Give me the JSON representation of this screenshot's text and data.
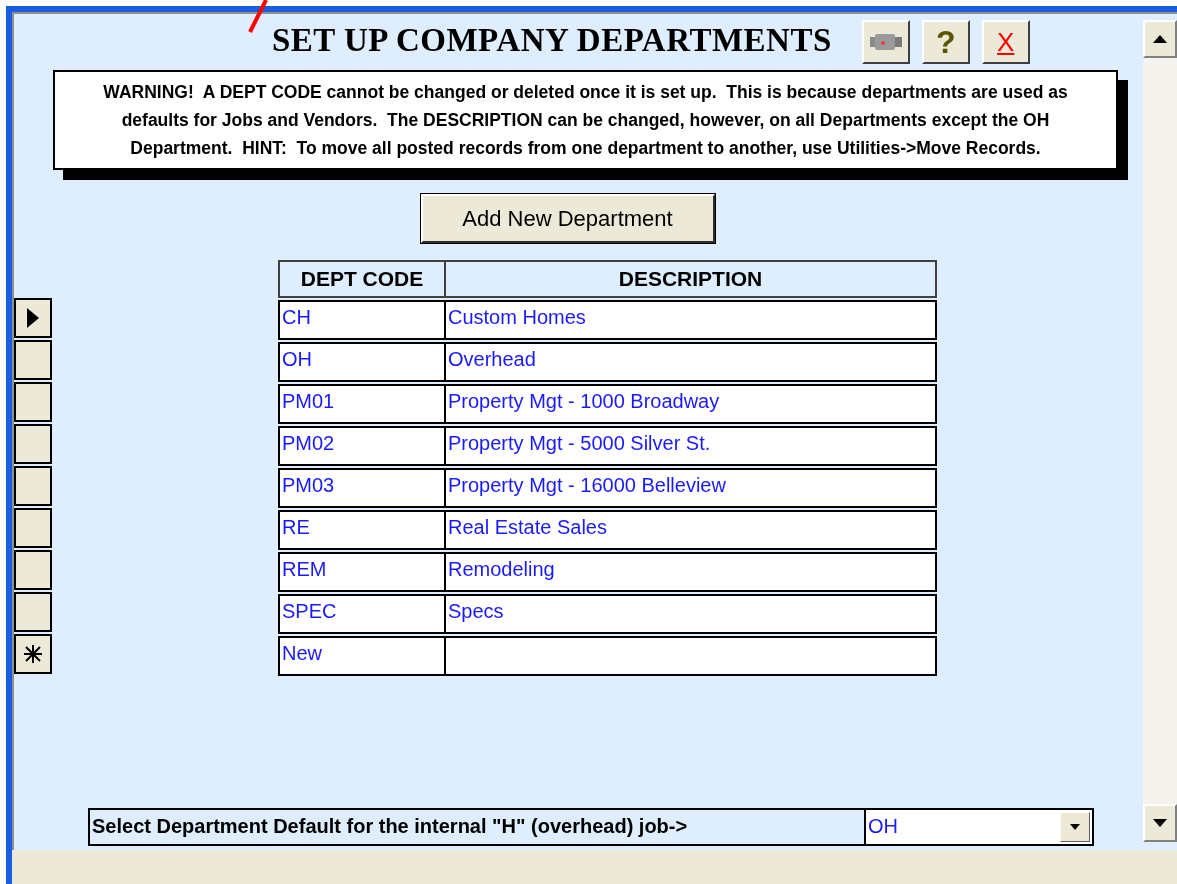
{
  "title": "SET UP COMPANY DEPARTMENTS",
  "toolbar": [
    {
      "kind": "video"
    },
    {
      "kind": "help",
      "label": "?"
    },
    {
      "kind": "close",
      "label": "X"
    }
  ],
  "warning": "WARNING!  A DEPT CODE cannot be changed or deleted once it is set up.  This is because departments are used as defaults for Jobs and Vendors.  The DESCRIPTION can be changed, however, on all Departments except the OH Department.  HINT:  To move all posted records from one department to another, use Utilities->Move Records.",
  "add_button": "Add New Department",
  "table": {
    "columns": [
      "DEPT CODE",
      "DESCRIPTION"
    ],
    "rows": [
      {
        "code": "CH",
        "description": "Custom Homes",
        "selected": true
      },
      {
        "code": "OH",
        "description": "Overhead",
        "selected": false
      },
      {
        "code": "PM01",
        "description": "Property Mgt - 1000 Broadway",
        "selected": false
      },
      {
        "code": "PM02",
        "description": "Property Mgt - 5000 Silver St.",
        "selected": false
      },
      {
        "code": "PM03",
        "description": "Property Mgt - 16000 Belleview",
        "selected": false
      },
      {
        "code": "RE",
        "description": "Real Estate Sales",
        "selected": false
      },
      {
        "code": "REM",
        "description": "Remodeling",
        "selected": false
      },
      {
        "code": "SPEC",
        "description": "Specs",
        "selected": false
      },
      {
        "code": "New",
        "kind": "new",
        "selected": false
      }
    ]
  },
  "default_select": {
    "label": "Select Department Default for the internal \"H\" (overhead) job->",
    "value": "OH"
  }
}
